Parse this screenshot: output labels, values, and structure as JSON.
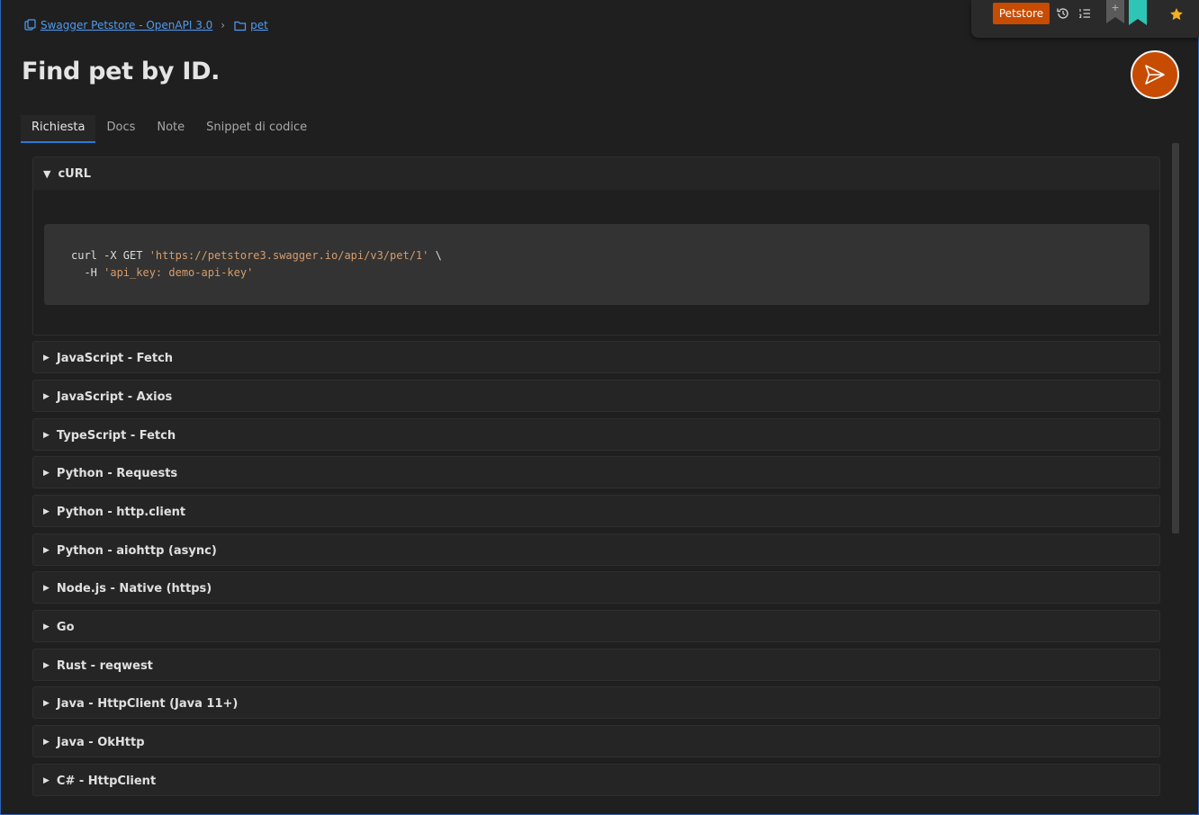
{
  "breadcrumb": {
    "collection": "Swagger Petstore - OpenAPI 3.0",
    "folder": "pet"
  },
  "toolbar": {
    "environment": "Petstore",
    "add_label": "+"
  },
  "page": {
    "title": "Find pet by ID."
  },
  "tabs": [
    {
      "label": "Richiesta",
      "active": true
    },
    {
      "label": "Docs",
      "active": false
    },
    {
      "label": "Note",
      "active": false
    },
    {
      "label": "Snippet di codice",
      "active": false
    }
  ],
  "curl": {
    "title": "cURL",
    "line1_cmd": "curl -X GET ",
    "line1_url": "'https://petstore3.swagger.io/api/v3/pet/1'",
    "line1_tail": " \\",
    "line2_cmd": "  -H ",
    "line2_header": "'api_key: demo-api-key'"
  },
  "snippets": [
    "JavaScript - Fetch",
    "JavaScript - Axios",
    "TypeScript - Fetch",
    "Python - Requests",
    "Python - http.client",
    "Python - aiohttp (async)",
    "Node.js - Native (https)",
    "Go",
    "Rust - reqwest",
    "Java - HttpClient (Java 11+)",
    "Java - OkHttp",
    "C# - HttpClient"
  ],
  "colors": {
    "accent": "#c74b00",
    "link": "#4f9bf0",
    "tab_underline": "#2f77d4",
    "bookmark_teal": "#2ec4b6",
    "star": "#f2b01e"
  }
}
